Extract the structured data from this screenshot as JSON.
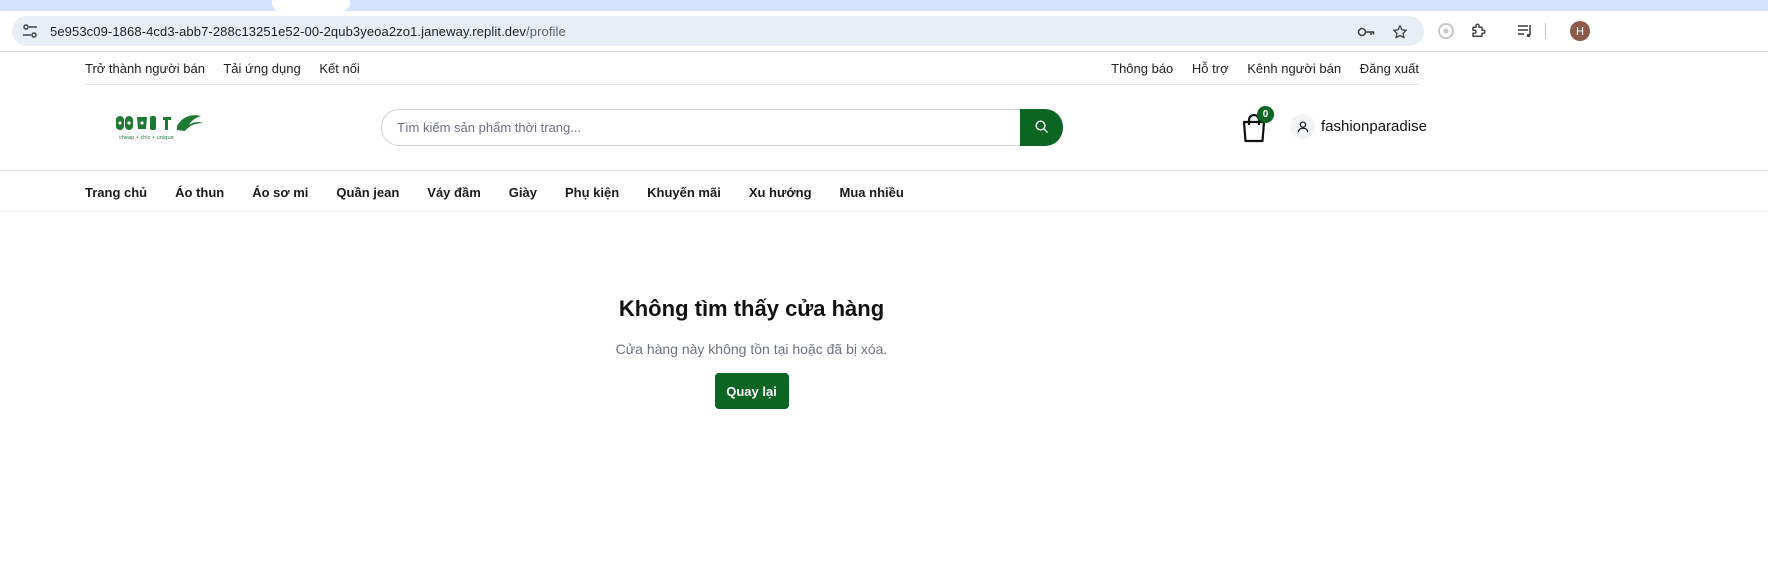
{
  "browser": {
    "url_host": "5e953c09-1868-4cd3-abb7-288c13251e52-00-2qub3yeoa2zo1.janeway.replit.dev",
    "url_path": "/profile",
    "profile_initial": "H"
  },
  "topbar": {
    "left": [
      "Trở thành người bán",
      "Tải ứng dụng",
      "Kết nối"
    ],
    "right": [
      "Thông báo",
      "Hỗ trợ",
      "Kênh người bán",
      "Đăng xuất"
    ]
  },
  "header": {
    "logo_tagline": "cheap • chic • unique",
    "search_placeholder": "Tìm kiếm sản phẩm thời trang...",
    "cart_count": "0",
    "username": "fashionparadise"
  },
  "nav": [
    "Trang chủ",
    "Áo thun",
    "Áo sơ mi",
    "Quần jean",
    "Váy đầm",
    "Giày",
    "Phụ kiện",
    "Khuyến mãi",
    "Xu hướng",
    "Mua nhiều"
  ],
  "main": {
    "title": "Không tìm thấy cửa hàng",
    "message": "Cửa hàng này không tồn tại hoặc đã bị xóa.",
    "back_button": "Quay lại"
  },
  "colors": {
    "brand": "#0b6523"
  },
  "icons": [
    "tune-icon",
    "key-icon",
    "star-icon",
    "extension-off-icon",
    "puzzle-icon",
    "media-icon",
    "search-icon",
    "shopping-bag-icon",
    "user-icon"
  ]
}
